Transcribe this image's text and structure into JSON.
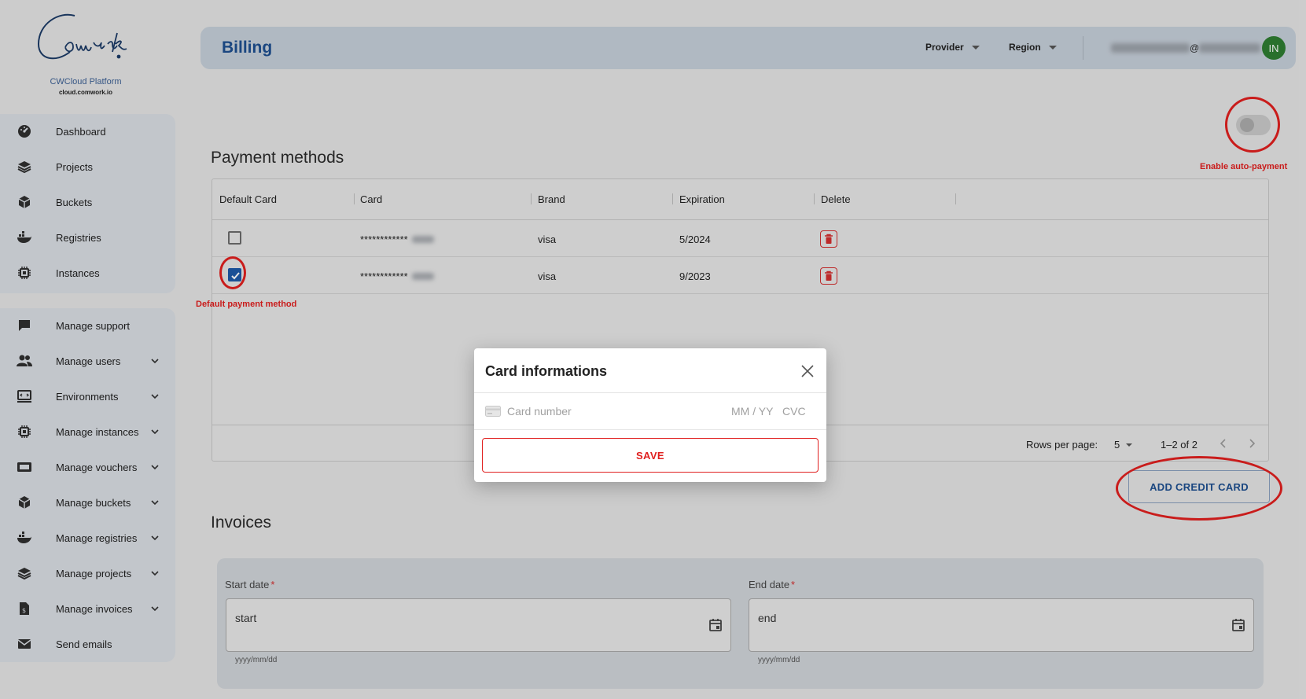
{
  "brand": {
    "logo_text": "Comwork",
    "platform": "CWCloud Platform",
    "domain": "cloud.comwork.io"
  },
  "sidebar": {
    "group1": [
      {
        "label": "Dashboard",
        "icon": "gauge-icon"
      },
      {
        "label": "Projects",
        "icon": "layers-icon"
      },
      {
        "label": "Buckets",
        "icon": "cube-icon"
      },
      {
        "label": "Registries",
        "icon": "docker-icon"
      },
      {
        "label": "Instances",
        "icon": "chip-icon"
      }
    ],
    "group2": [
      {
        "label": "Manage support",
        "icon": "chat-icon",
        "expandable": false
      },
      {
        "label": "Manage users",
        "icon": "users-icon",
        "expandable": true
      },
      {
        "label": "Environments",
        "icon": "monitor-code-icon",
        "expandable": true
      },
      {
        "label": "Manage instances",
        "icon": "chip-icon",
        "expandable": true
      },
      {
        "label": "Manage vouchers",
        "icon": "voucher-icon",
        "expandable": true
      },
      {
        "label": "Manage buckets",
        "icon": "cube-icon",
        "expandable": true
      },
      {
        "label": "Manage registries",
        "icon": "docker-icon",
        "expandable": true
      },
      {
        "label": "Manage projects",
        "icon": "layers-icon",
        "expandable": true
      },
      {
        "label": "Manage invoices",
        "icon": "invoice-icon",
        "expandable": true
      },
      {
        "label": "Send emails",
        "icon": "mail-icon",
        "expandable": false
      }
    ]
  },
  "header": {
    "title": "Billing",
    "provider_label": "Provider",
    "region_label": "Region",
    "email_at": "@",
    "avatar_initials": "IN"
  },
  "auto_payment": {
    "enabled": false,
    "annotation": "Enable auto-payment"
  },
  "payment_methods": {
    "title": "Payment methods",
    "columns": [
      "Default Card",
      "Card",
      "Brand",
      "Expiration",
      "Delete"
    ],
    "rows": [
      {
        "default": false,
        "card_mask": "************",
        "brand": "visa",
        "expiration": "5/2024"
      },
      {
        "default": true,
        "card_mask": "************",
        "brand": "visa",
        "expiration": "9/2023"
      }
    ],
    "default_annotation": "Default payment method",
    "rows_per_page_label": "Rows per page:",
    "rows_per_page_value": "5",
    "range": "1–2 of 2",
    "add_card_label": "ADD CREDIT CARD"
  },
  "invoices": {
    "title": "Invoices",
    "start_label": "Start date",
    "start_value": "start",
    "start_hint": "yyyy/mm/dd",
    "end_label": "End date",
    "end_value": "end",
    "end_hint": "yyyy/mm/dd",
    "required_mark": "*"
  },
  "modal": {
    "title": "Card informations",
    "card_number_placeholder": "Card number",
    "expiry_placeholder": "MM / YY",
    "cvc_placeholder": "CVC",
    "save_label": "SAVE"
  },
  "colors": {
    "accent": "#1d4f8f",
    "danger": "#e0201f",
    "avatar": "#2e7d32"
  }
}
